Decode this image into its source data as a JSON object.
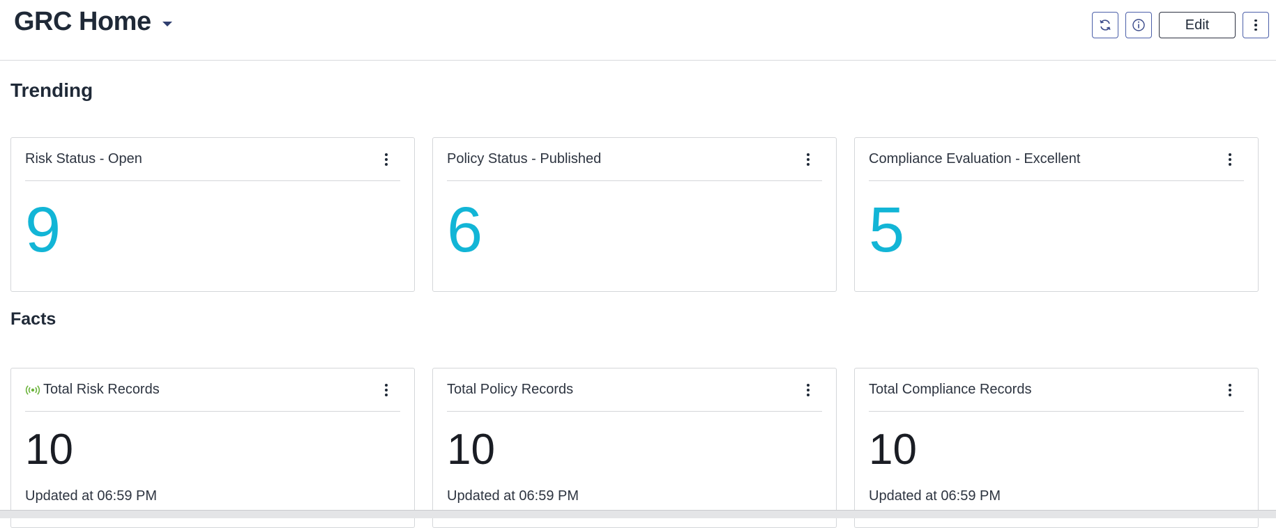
{
  "header": {
    "title": "GRC Home",
    "actions": {
      "refresh_icon": "refresh-icon",
      "info_icon": "info-icon",
      "edit_label": "Edit",
      "more_icon": "more-vertical-icon"
    }
  },
  "sections": {
    "trending": "Trending",
    "facts": "Facts"
  },
  "trending_cards": [
    {
      "title": "Risk Status - Open",
      "value": "9"
    },
    {
      "title": "Policy Status - Published",
      "value": "6"
    },
    {
      "title": "Compliance Evaluation - Excellent",
      "value": "5"
    }
  ],
  "fact_cards": [
    {
      "title": "Total Risk Records",
      "value": "10",
      "updated": "Updated at 06:59 PM",
      "icon": "live-signal-icon"
    },
    {
      "title": "Total Policy Records",
      "value": "10",
      "updated": "Updated at 06:59 PM"
    },
    {
      "title": "Total Compliance Records",
      "value": "10",
      "updated": "Updated at 06:59 PM"
    }
  ],
  "colors": {
    "accent_number": "#12b5d6",
    "button_border": "#4b5fa8",
    "live_icon": "#6bb33a"
  }
}
